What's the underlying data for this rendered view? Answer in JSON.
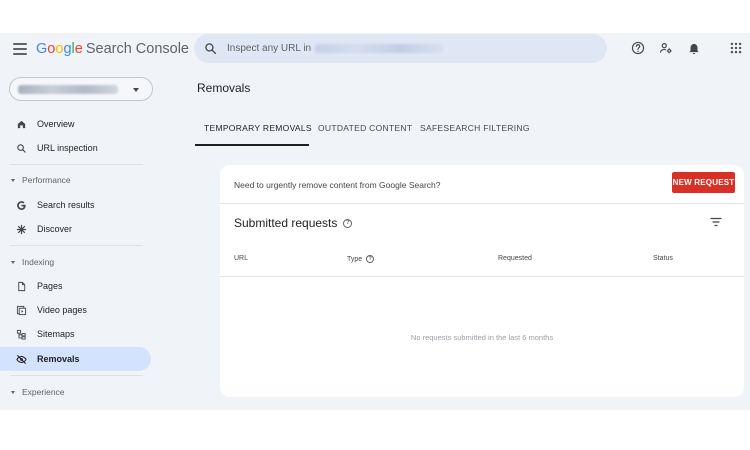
{
  "header": {
    "logo_google": "Google",
    "logo_product": "Search Console",
    "search_placeholder": "Inspect any URL in",
    "icons": [
      "menu-icon",
      "search-icon",
      "help-icon",
      "manage-users-icon",
      "notifications-icon",
      "apps-grid-icon"
    ]
  },
  "colors": {
    "google_blue": "#4285F4",
    "google_red": "#EA4335",
    "google_yellow": "#FBBC05",
    "google_green": "#34A853",
    "active_nav": "#d3e3fd",
    "primary_button": "#d93025",
    "background": "#f0f4f9"
  },
  "sidebar": {
    "items": [
      {
        "label": "Overview",
        "icon": "home-icon"
      },
      {
        "label": "URL inspection",
        "icon": "search-icon"
      },
      {
        "label": "Search results",
        "icon": "google-g-icon"
      },
      {
        "label": "Discover",
        "icon": "asterisk-icon"
      },
      {
        "label": "Pages",
        "icon": "pages-icon"
      },
      {
        "label": "Video pages",
        "icon": "video-pages-icon"
      },
      {
        "label": "Sitemaps",
        "icon": "sitemap-icon"
      },
      {
        "label": "Removals",
        "icon": "eye-off-icon",
        "active": true
      }
    ],
    "sections": [
      "Performance",
      "Indexing",
      "Experience"
    ]
  },
  "main": {
    "title": "Removals",
    "tabs": [
      {
        "label": "TEMPORARY REMOVALS",
        "active": true
      },
      {
        "label": "OUTDATED CONTENT"
      },
      {
        "label": "SAFESEARCH FILTERING"
      }
    ],
    "card": {
      "notice": "Need to urgently remove content from Google Search?",
      "new_request_label": "NEW REQUEST",
      "subheading": "Submitted requests",
      "columns": [
        "URL",
        "Type",
        "Requested",
        "Status"
      ],
      "empty_message": "No requests submitted in the last 6 months"
    }
  }
}
